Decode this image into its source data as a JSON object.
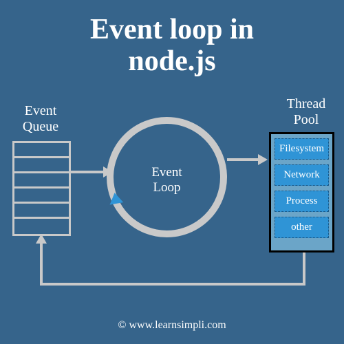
{
  "title_line1": "Event loop in",
  "title_line2": "node.js",
  "queue_label": "Event Queue",
  "loop_label_line1": "Event",
  "loop_label_line2": "Loop",
  "pool_label": "Thread Pool",
  "pool_items": [
    "Filesystem",
    "Network",
    "Process",
    "other"
  ],
  "footer": "© www.learnsimpli.com",
  "colors": {
    "background": "#36648b",
    "gray": "#c9c9c9",
    "pool_item": "#2f94d6",
    "pool_box": "#6ba5c8"
  }
}
